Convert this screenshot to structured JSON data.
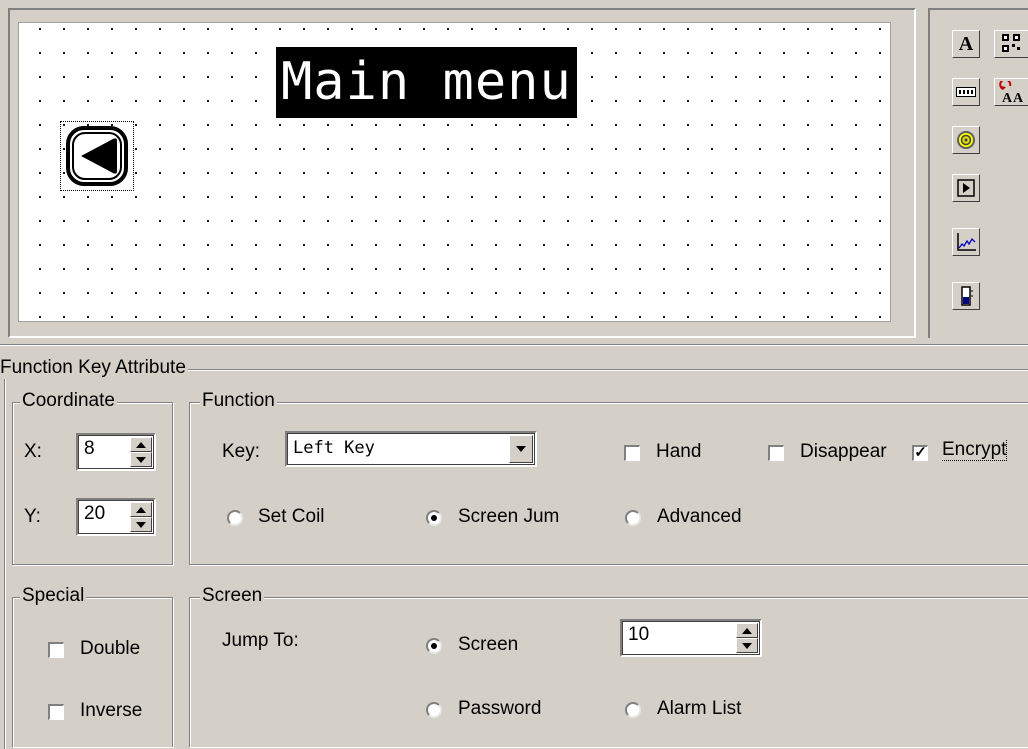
{
  "canvas": {
    "title_text": "Main menu"
  },
  "toolbar": {
    "text_tool_glyph": "A"
  },
  "function_key_attribute": {
    "title": "Function Key Attribute",
    "coordinate": {
      "label": "Coordinate",
      "x_label": "X:",
      "x_value": "8",
      "y_label": "Y:",
      "y_value": "20"
    },
    "function": {
      "label": "Function",
      "key_label": "Key:",
      "key_value": "Left Key",
      "hand_label": "Hand",
      "hand_checked": false,
      "disappear_label": "Disappear",
      "disappear_checked": false,
      "encrypt_label": "Encrypt",
      "encrypt_checked": true,
      "set_coil_label": "Set Coil",
      "screen_jump_label": "Screen Jum",
      "advanced_label": "Advanced",
      "selected_mode": "Screen Jump"
    },
    "special": {
      "label": "Special",
      "double_label": "Double",
      "double_checked": false,
      "inverse_label": "Inverse",
      "inverse_checked": false
    },
    "screen": {
      "label": "Screen",
      "jump_to_label": "Jump To:",
      "screen_option_label": "Screen",
      "screen_number": "10",
      "password_label": "Password",
      "alarm_list_label": "Alarm List",
      "selected_target": "Screen"
    }
  }
}
